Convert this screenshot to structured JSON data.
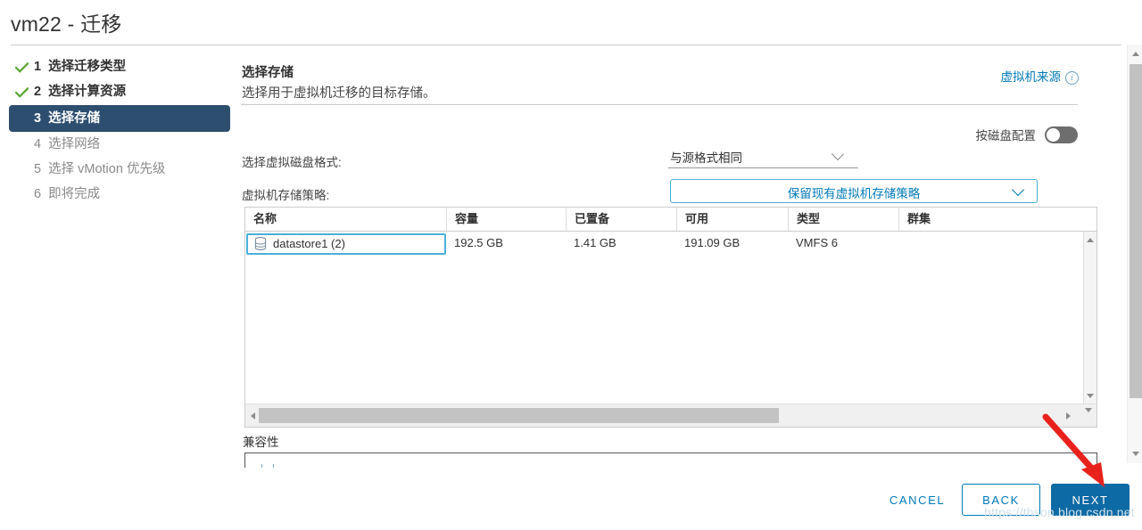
{
  "window": {
    "title": "vm22 - 迁移"
  },
  "steps": [
    {
      "number": "1",
      "label": "选择迁移类型",
      "state": "done"
    },
    {
      "number": "2",
      "label": "选择计算资源",
      "state": "done"
    },
    {
      "number": "3",
      "label": "选择存储",
      "state": "active"
    },
    {
      "number": "4",
      "label": "选择网络",
      "state": "pending"
    },
    {
      "number": "5",
      "label": "选择 vMotion 优先级",
      "state": "pending"
    },
    {
      "number": "6",
      "label": "即将完成",
      "state": "pending"
    }
  ],
  "panel": {
    "title": "选择存储",
    "subtitle": "选择用于虚拟机迁移的目标存储。",
    "vm_source_link": "虚拟机来源",
    "info_icon_glyph": "i",
    "per_disk_label": "按磁盘配置",
    "per_disk_state": "off"
  },
  "form": {
    "disk_format_label": "选择虚拟磁盘格式:",
    "disk_format_value": "与源格式相同",
    "storage_policy_label": "虚拟机存储策略:",
    "storage_policy_value": "保留现有虚拟机存储策略"
  },
  "table": {
    "columns": [
      "名称",
      "容量",
      "已置备",
      "可用",
      "类型",
      "群集"
    ],
    "rows": [
      {
        "name": "datastore1 (2)",
        "capacity": "192.5 GB",
        "provisioned": "1.41 GB",
        "free": "191.09 GB",
        "type": "VMFS 6",
        "cluster": "",
        "selected": true,
        "icon": "datastore-icon"
      }
    ]
  },
  "compatibility": {
    "label": "兼容性"
  },
  "footer": {
    "cancel_label": "CANCEL",
    "back_label": "BACK",
    "next_label": "NEXT"
  },
  "annotation": {
    "arrow_color": "#e8211c",
    "watermark": "https://thson.blog.csdn.net"
  },
  "colors": {
    "accent_blue": "#0079b8",
    "primary_button": "#0e6aa4",
    "active_step": "#2d4e6f",
    "selection_border": "#49afd9",
    "check_green": "#5aa532"
  }
}
